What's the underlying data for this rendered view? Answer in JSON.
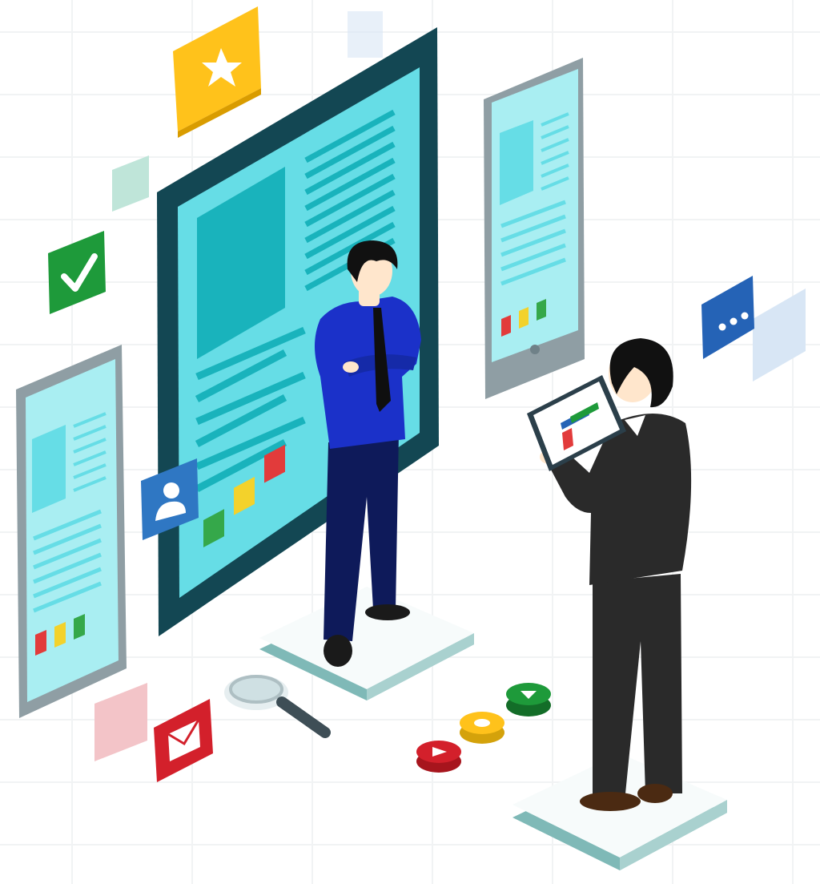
{
  "colors": {
    "background": "#ffffff",
    "grid_lines": "#f1f3f4",
    "screen_cyan": "#66dde6",
    "screen_cyan_light": "#a9eef2",
    "screen_teal": "#19b3bc",
    "monitor_frame": "#134753",
    "device_frame": "#8f9ea4",
    "star_badge": "#ffc21b",
    "check_badge": "#1e9a3a",
    "mail_badge": "#d3202b",
    "user_badge": "#2f77c3",
    "chat_badge": "#2563b6",
    "swatch_red": "#e23b3b",
    "swatch_yellow": "#f3d22b",
    "swatch_green": "#35a84a",
    "man_shirt": "#1b31c9",
    "man_trousers": "#0e1a5a",
    "suit_dark": "#2a2a2a",
    "hair": "#111111",
    "skin": "#ffe6cc",
    "platform_top": "#f7fbfb",
    "platform_edge": "#7fb9b7",
    "floating_pink": "#f3c4c8",
    "floating_mint": "#bfe5d9",
    "floating_blue": "#d8e6f5"
  },
  "icons": [
    "star-icon",
    "checkmark-icon",
    "user-profile-icon",
    "envelope-icon",
    "chat-dots-icon",
    "magnifier-icon",
    "play-button-red-icon",
    "record-button-yellow-icon",
    "play-button-green-icon",
    "chart-tablet-icon"
  ]
}
